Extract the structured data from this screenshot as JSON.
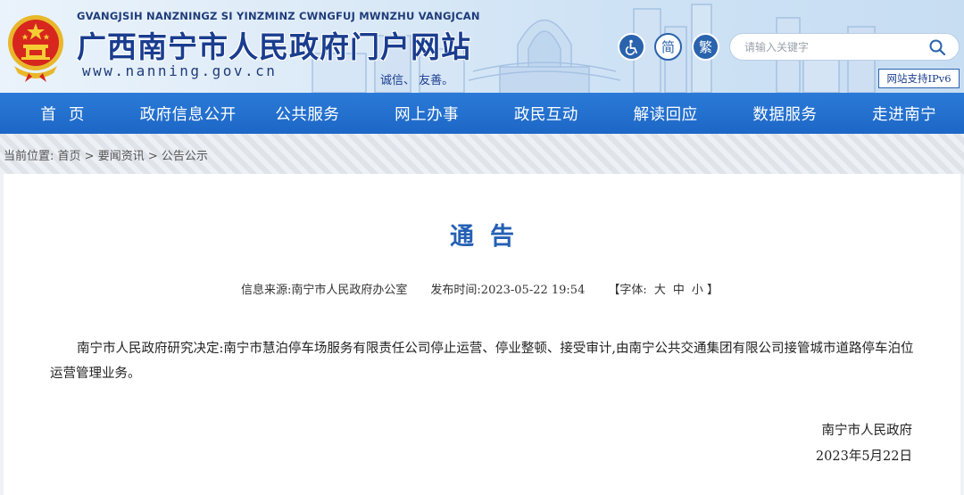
{
  "header": {
    "pinyin": "GVANGJSIH NANZNINGZ SI YINZMINZ CWNGFUJ MWNZHU VANGJCAN",
    "site_title": "广西南宁市人民政府门户网站",
    "site_url": "www.nanning.gov.cn",
    "slogan": "诚信、 友善。",
    "simplified_label": "简",
    "traditional_label": "繁",
    "accessibility_icon": "wheelchair-icon",
    "search_placeholder": "请输入关键字",
    "search_icon": "search-icon",
    "ipv6_label": "网站支持IPv6"
  },
  "nav": {
    "items": [
      "首页",
      "政府信息公开",
      "公共服务",
      "网上办事",
      "政民互动",
      "解读回应",
      "数据服务",
      "走进南宁"
    ]
  },
  "breadcrumb": {
    "prefix": "当前位置:",
    "items": [
      "首页",
      "要闻资讯",
      "公告公示"
    ],
    "separator": " > "
  },
  "article": {
    "title": "通告",
    "source_label": "信息来源:",
    "source": "南宁市人民政府办公室",
    "date_label": "发布时间:",
    "date": "2023-05-22 19:54",
    "font_label": "【字体:",
    "font_sizes": [
      "大",
      "中",
      "小"
    ],
    "font_close": "】",
    "body": "南宁市人民政府研究决定:南宁市慧泊停车场服务有限责任公司停止运营、停业整顿、接受审计,由南宁公共交通集团有限公司接管城市道路停车泊位运营管理业务。",
    "sign_org": "南宁市人民政府",
    "sign_date": "2023年5月22日"
  },
  "colors": {
    "nav_bg": "#1f6fd0",
    "title_blue": "#2560b4",
    "header_text": "#1a3d8f"
  }
}
